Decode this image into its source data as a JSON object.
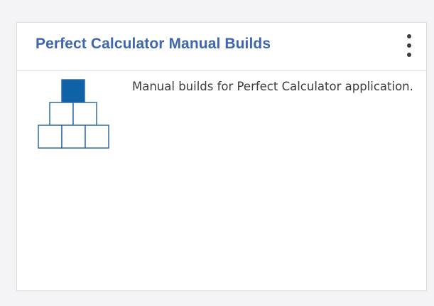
{
  "card": {
    "title": "Perfect Calculator Manual Builds",
    "description": "Manual builds for Perfect Calculator application.",
    "menu_icon": "kebab-menu-icon",
    "illustration_icon": "block-pyramid-icon"
  },
  "colors": {
    "title": "#3f66b1",
    "icon_fill": "#0f62a7",
    "icon_stroke": "#2f6aa7",
    "text": "#3b3b3b",
    "border": "#dcdcdc",
    "background": "#f4f4f6"
  }
}
